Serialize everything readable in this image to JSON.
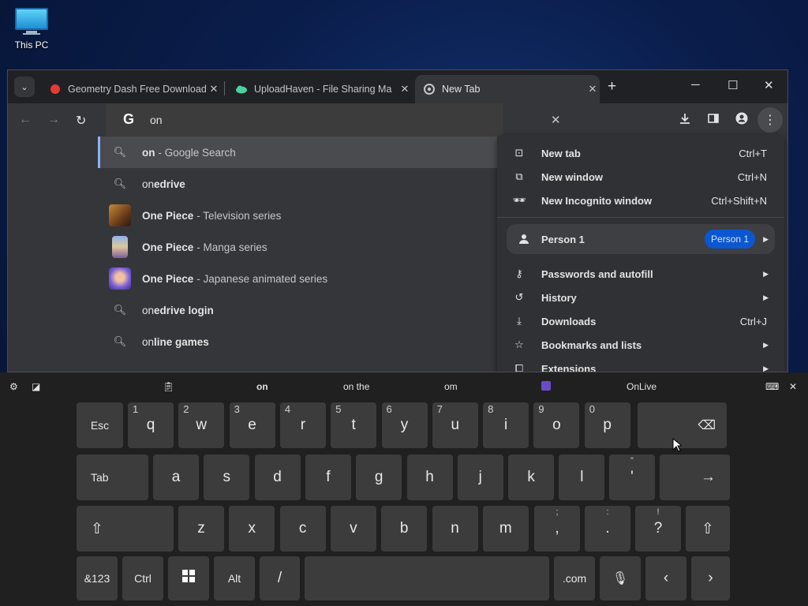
{
  "desktop": {
    "icon_label": "This PC"
  },
  "browser": {
    "tabs": [
      {
        "title": "Geometry Dash Free Download",
        "active": false
      },
      {
        "title": "UploadHaven - File Sharing Ma",
        "active": false
      },
      {
        "title": "New Tab",
        "active": true
      }
    ],
    "omnibox": {
      "logo": "G",
      "text": "on"
    }
  },
  "suggestions": [
    {
      "icon": "search-icon",
      "bold": "on",
      "rest": "",
      "sub": "- Google Search",
      "selected": true
    },
    {
      "icon": "search-icon",
      "bold": "on",
      "rest": "edrive",
      "sub": ""
    },
    {
      "icon": "thumbnail",
      "bold": "One Piece",
      "rest": "",
      "sub": "- Television series"
    },
    {
      "icon": "thumbnail",
      "bold": "One Piece",
      "rest": "",
      "sub": "- Manga series"
    },
    {
      "icon": "thumbnail",
      "bold": "One Piece",
      "rest": "",
      "sub": "- Japanese animated series"
    },
    {
      "icon": "search-icon",
      "bold": "on",
      "rest": "edrive login",
      "sub": ""
    },
    {
      "icon": "search-icon",
      "bold": "on",
      "rest": "line games",
      "sub": ""
    }
  ],
  "menu": {
    "new_tab": {
      "label": "New tab",
      "shortcut": "Ctrl+T"
    },
    "new_window": {
      "label": "New window",
      "shortcut": "Ctrl+N"
    },
    "new_incognito": {
      "label": "New Incognito window",
      "shortcut": "Ctrl+Shift+N"
    },
    "profile": {
      "label": "Person 1",
      "badge": "Person 1"
    },
    "passwords": {
      "label": "Passwords and autofill"
    },
    "history": {
      "label": "History"
    },
    "downloads": {
      "label": "Downloads",
      "shortcut": "Ctrl+J"
    },
    "bookmarks": {
      "label": "Bookmarks and lists"
    },
    "extensions": {
      "label": "Extensions"
    }
  },
  "keyboard": {
    "candidates": [
      "on",
      "on the",
      "om",
      "OnLive"
    ],
    "row1": [
      {
        "k": "q",
        "n": "1"
      },
      {
        "k": "w",
        "n": "2"
      },
      {
        "k": "e",
        "n": "3"
      },
      {
        "k": "r",
        "n": "4"
      },
      {
        "k": "t",
        "n": "5"
      },
      {
        "k": "y",
        "n": "6"
      },
      {
        "k": "u",
        "n": "7"
      },
      {
        "k": "i",
        "n": "8"
      },
      {
        "k": "o",
        "n": "9"
      },
      {
        "k": "p",
        "n": "0"
      }
    ],
    "row2": [
      "a",
      "s",
      "d",
      "f",
      "g",
      "h",
      "j",
      "k",
      "l"
    ],
    "row3": [
      "z",
      "x",
      "c",
      "v",
      "b",
      "n",
      "m"
    ],
    "labels": {
      "esc": "Esc",
      "tab": "Tab",
      "sym": "&123",
      "ctrl": "Ctrl",
      "alt": "Alt",
      "slash": "/",
      "com": ".com"
    },
    "punct": {
      "apos": {
        "up": "\"",
        "main": "'"
      },
      "comma": {
        "up": ";",
        "main": ","
      },
      "period": {
        "up": ":",
        "main": "."
      },
      "question": {
        "up": "!",
        "main": "?"
      }
    }
  }
}
